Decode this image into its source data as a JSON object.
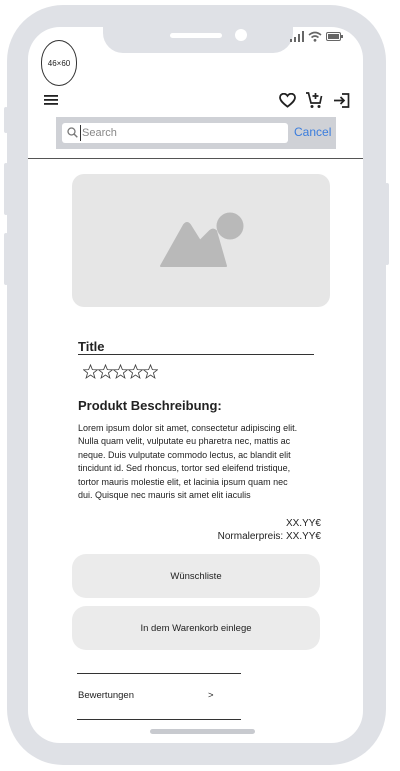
{
  "avatar": {
    "label": "46×60"
  },
  "search": {
    "placeholder": "Search",
    "value": "",
    "cancel_label": "Cancel"
  },
  "product": {
    "title": "Title",
    "rating": {
      "max": 5,
      "value": 0
    },
    "description_heading": "Produkt Beschreibung:",
    "description": "Lorem ipsum dolor sit amet, consectetur adipiscing elit. Nulla quam velit, vulputate eu pharetra nec, mattis ac neque. Duis vulputate commodo lectus, ac blandit elit tincidunt id. Sed rhoncus, tortor sed eleifend tristique, tortor mauris molestie elit, et lacinia ipsum quam nec dui. Quisque nec mauris sit amet elit iaculis",
    "price": "XX.YY€",
    "normal_price": "Normalerpreis: XX.YY€"
  },
  "actions": {
    "wishlist_label": "Wünschliste",
    "cart_label": "In dem Warenkorb einlege"
  },
  "reviews": {
    "label": "Bewertungen",
    "chevron": ">"
  },
  "icons": {
    "menu": "hamburger-menu-icon",
    "favorite": "heart-icon",
    "cart": "add-to-cart-icon",
    "login": "login-icon",
    "search": "search-icon",
    "image": "image-placeholder-icon",
    "star": "star-outline-icon"
  },
  "colors": {
    "frame": "#dfe1e6",
    "link": "#3b7ddd",
    "button": "#ebebeb",
    "placeholder": "#e6e6e6"
  }
}
